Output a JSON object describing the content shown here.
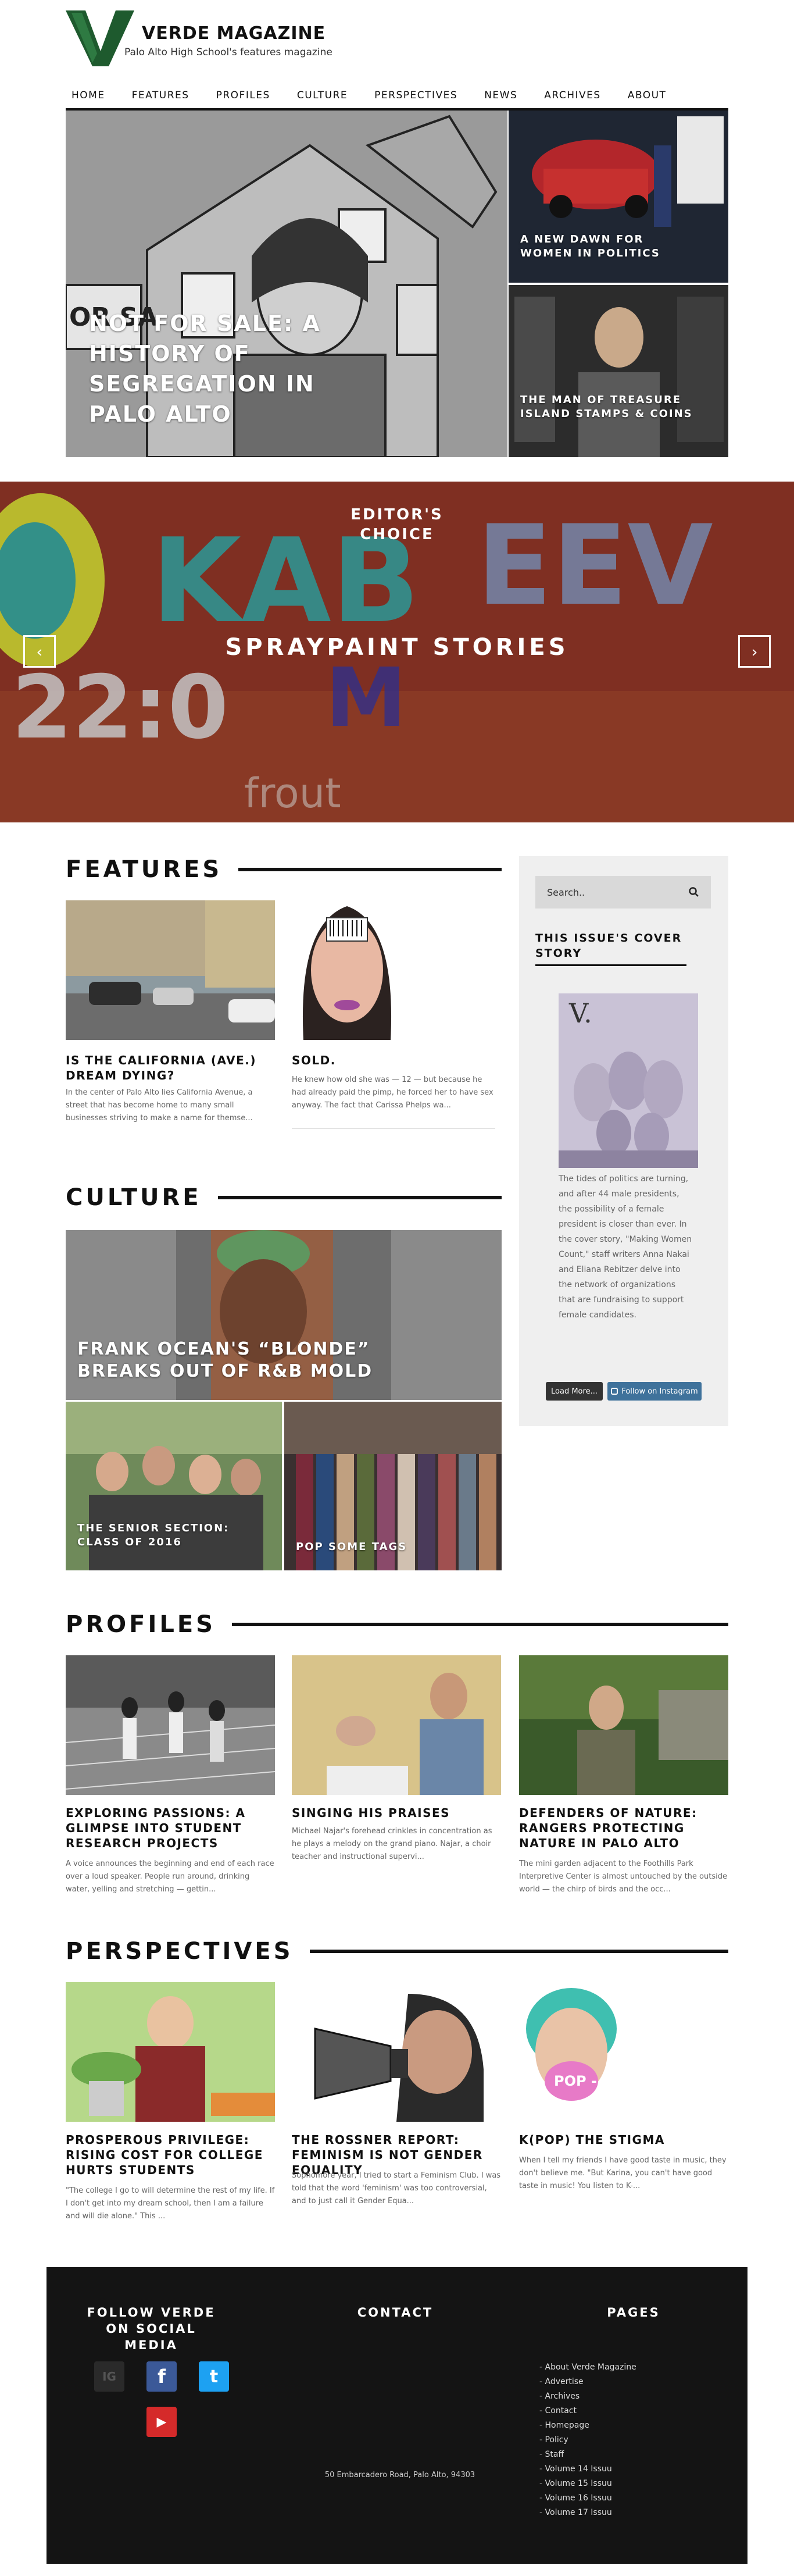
{
  "header": {
    "name": "VERDE MAGAZINE",
    "tagline": "Palo Alto High School's features magazine",
    "brand_color": "#1e5a2e"
  },
  "nav": [
    "HOME",
    "FEATURES",
    "PROFILES",
    "CULTURE",
    "PERSPECTIVES",
    "NEWS",
    "ARCHIVES",
    "ABOUT"
  ],
  "hero": {
    "main": "NOT FOR SALE: A HISTORY OF SEGREGATION IN PALO ALTO",
    "top_right": "A NEW DAWN FOR WOMEN IN POLITICS",
    "bottom_right": "THE MAN OF TREASURE ISLAND STAMPS & COINS"
  },
  "slider": {
    "tag": "EDITOR'S CHOICE",
    "title": "SPRAYPAINT STORIES",
    "prev": "‹",
    "next": "›"
  },
  "features": {
    "heading": "FEATURES",
    "items": [
      {
        "title": "IS THE CALIFORNIA (AVE.) DREAM DYING?",
        "excerpt": "In the center of Palo Alto lies California Avenue, a street that has become home to many small businesses striving to make a name for themse..."
      },
      {
        "title": "SOLD.",
        "excerpt": "He knew how old she was — 12 — but because he had already paid the pimp, he forced her to have sex anyway. The fact that Carissa Phelps wa..."
      }
    ]
  },
  "sidebar": {
    "search_placeholder": "Search..",
    "cover_heading": "THIS ISSUE'S COVER STORY",
    "cover_text": "The tides of politics are turning, and after 44 male presidents, the possibility of a female president is closer than ever. In the cover story, \"Making Women Count,\" staff writers Anna Nakai and Eliana Rebitzer delve into the network of organizations that are fundraising to support female candidates.",
    "load_more": "Load More...",
    "instagram": "Follow on Instagram"
  },
  "culture": {
    "heading": "CULTURE",
    "main": "FRANK OCEAN'S “BLONDE” BREAKS OUT OF R&B MOLD",
    "left": "THE SENIOR SECTION: CLASS OF 2016",
    "right": "POP SOME TAGS"
  },
  "profiles": {
    "heading": "PROFILES",
    "items": [
      {
        "title": "EXPLORING PASSIONS: A GLIMPSE INTO STUDENT RESEARCH PROJECTS",
        "excerpt": "A voice announces the beginning and end of each race over a loud speaker. People run around, drinking water, yelling and stretching — gettin..."
      },
      {
        "title": "SINGING HIS PRAISES",
        "excerpt": "Michael Najar's forehead crinkles in concentration as he plays a melody on the grand piano. Najar, a choir teacher and instructional supervi..."
      },
      {
        "title": "DEFENDERS OF NATURE: RANGERS PROTECTING NATURE IN PALO ALTO",
        "excerpt": "The mini garden adjacent to the Foothills Park Interpretive Center is almost untouched by the outside world — the chirp of birds and the occ..."
      }
    ]
  },
  "perspectives": {
    "heading": "PERSPECTIVES",
    "items": [
      {
        "title": "PROSPEROUS PRIVILEGE: RISING COST FOR COLLEGE HURTS STUDENTS",
        "excerpt": "\"The college I go to will determine the rest of my life. If I don't get into my dream school, then I am a failure and will die alone.\" This ..."
      },
      {
        "title": "THE ROSSNER REPORT: FEMINISM IS NOT GENDER EQUALITY",
        "excerpt": "Sophomore year, I tried to start a Feminism Club. I was told that the word 'feminism' was too controversial, and to just call it Gender Equa..."
      },
      {
        "title": "K(POP) THE STIGMA",
        "excerpt": "When I tell my friends I have good taste in music, they don't believe me. \"But Karina, you can't have good taste in music! You listen to K-...",
        "art_text": "POP - THE STIGMA"
      }
    ]
  },
  "footer": {
    "social_heading": "FOLLOW VERDE ON SOCIAL MEDIA",
    "contact_heading": "CONTACT",
    "pages_heading": "PAGES",
    "address": "50 Embarcadero Road, Palo Alto, 94303",
    "pages": [
      "About Verde Magazine",
      "Advertise",
      "Archives",
      "Contact",
      "Homepage",
      "Policy",
      "Staff",
      "Volume 14 Issuu",
      "Volume 15 Issuu",
      "Volume 16 Issuu",
      "Volume 17 Issuu"
    ],
    "icons": {
      "instagram": "IG",
      "facebook": "f",
      "twitter": "t",
      "youtube": "▶"
    }
  }
}
